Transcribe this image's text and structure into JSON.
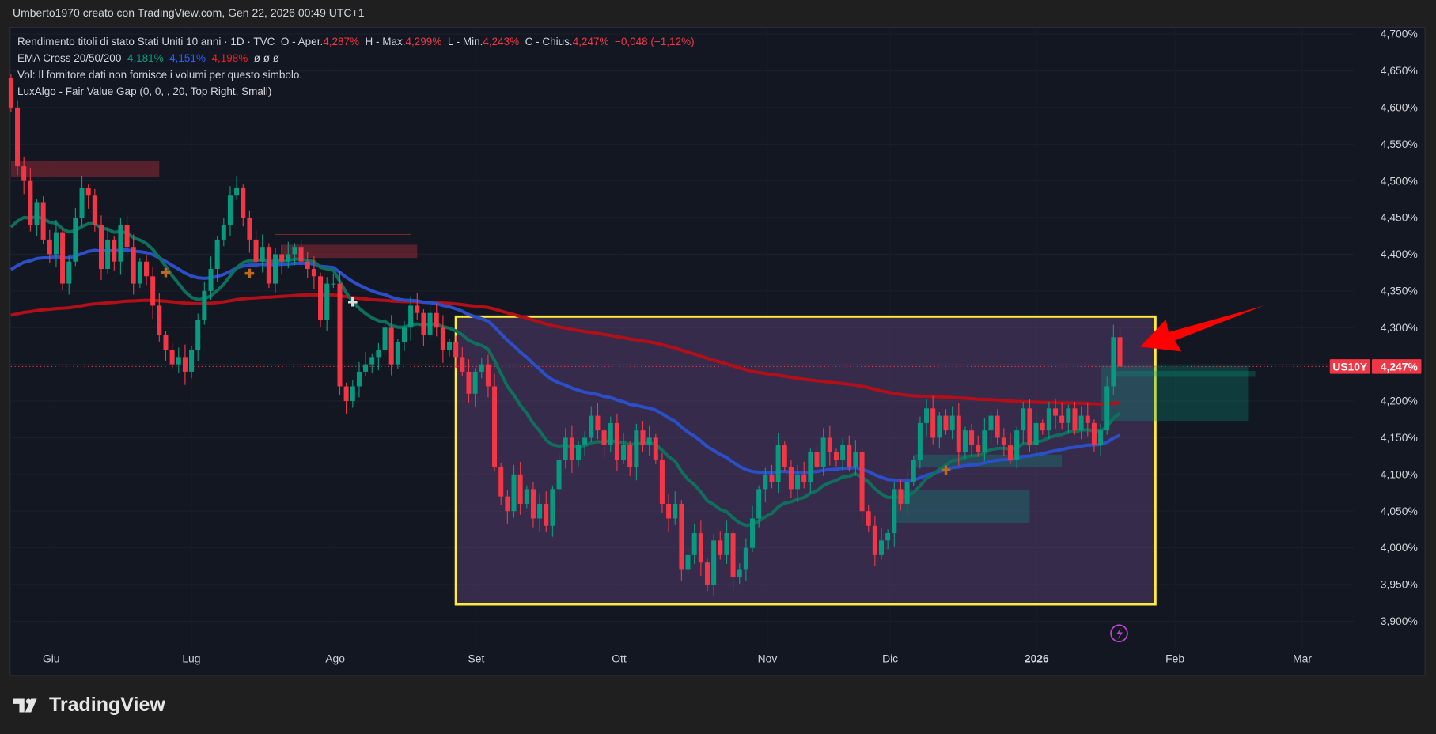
{
  "attribution": "Umberto1970 creato con TradingView.com, Gen 22, 2026 00:49 UTC+1",
  "legend": {
    "symbol": "Rendimento titoli di stato Stati Uniti 10 anni · 1D · TVC",
    "open_label": "O - Aper.",
    "open": "4,287%",
    "high_label": "H - Max.",
    "high": "4,299%",
    "low_label": "L - Min.",
    "low": "4,243%",
    "close_label": "C - Chius.",
    "close": "4,247%",
    "change": "−0,048 (−1,12%)",
    "ema_label": "EMA Cross 20/50/200",
    "ema20": "4,181%",
    "ema50": "4,151%",
    "ema200": "4,198%",
    "ema_extra": "ø  ø  ø",
    "vol": "Vol: Il fornitore dati non fornisce i volumi per questo simbolo.",
    "fvg": "LuxAlgo - Fair Value Gap (0, 0, , 20, Top Right, Small)"
  },
  "price_tag": {
    "symbol": "US10Y",
    "value": "4,247%"
  },
  "brand": "TradingView",
  "colors": {
    "up": "#089981",
    "down": "#f23645",
    "ema20": "#0e6f5c",
    "ema50": "#2b4fc9",
    "ema200": "#b20f19",
    "box": "#ffeb3b",
    "arrow": "#ff0000"
  },
  "chart_data": {
    "type": "candlestick",
    "title": "Rendimento titoli di stato Stati Uniti 10 anni · 1D · TVC",
    "ylabel": "%",
    "ylim": [
      3.88,
      4.72
    ],
    "y_ticks": [
      "4,700%",
      "4,650%",
      "4,600%",
      "4,550%",
      "4,500%",
      "4,450%",
      "4,400%",
      "4,350%",
      "4,300%",
      "4,250%",
      "4,200%",
      "4,150%",
      "4,100%",
      "4,050%",
      "4,000%",
      "3,950%",
      "3,900%"
    ],
    "y_tick_values": [
      4.7,
      4.65,
      4.6,
      4.55,
      4.5,
      4.45,
      4.4,
      4.35,
      4.3,
      4.25,
      4.2,
      4.15,
      4.1,
      4.05,
      4.0,
      3.95,
      3.9
    ],
    "x_ticks": [
      "Giu",
      "Lug",
      "Ago",
      "Set",
      "Ott",
      "Nov",
      "Dic",
      "2026",
      "Feb",
      "Mar"
    ],
    "first_open": 4.64,
    "closes": [
      4.6,
      4.52,
      4.5,
      4.44,
      4.47,
      4.42,
      4.4,
      4.43,
      4.36,
      4.39,
      4.45,
      4.49,
      4.48,
      4.44,
      4.38,
      4.42,
      4.39,
      4.44,
      4.41,
      4.36,
      4.39,
      4.37,
      4.33,
      4.29,
      4.27,
      4.25,
      4.26,
      4.24,
      4.27,
      4.31,
      4.35,
      4.38,
      4.42,
      4.44,
      4.48,
      4.49,
      4.45,
      4.42,
      4.39,
      4.41,
      4.36,
      4.4,
      4.39,
      4.4,
      4.41,
      4.39,
      4.38,
      4.37,
      4.31,
      4.36,
      4.36,
      4.22,
      4.2,
      4.22,
      4.24,
      4.25,
      4.26,
      4.27,
      4.3,
      4.25,
      4.28,
      4.3,
      4.33,
      4.32,
      4.29,
      4.32,
      4.3,
      4.27,
      4.28,
      4.26,
      4.24,
      4.21,
      4.24,
      4.25,
      4.22,
      4.11,
      4.07,
      4.05,
      4.1,
      4.06,
      4.08,
      4.04,
      4.06,
      4.03,
      4.08,
      4.12,
      4.15,
      4.12,
      4.14,
      4.15,
      4.18,
      4.16,
      4.14,
      4.17,
      4.12,
      4.14,
      4.11,
      4.16,
      4.14,
      4.15,
      4.12,
      4.06,
      4.04,
      4.06,
      3.97,
      3.99,
      4.02,
      3.98,
      3.95,
      4.01,
      3.99,
      4.02,
      3.96,
      3.97,
      4.0,
      4.04,
      4.08,
      4.1,
      4.09,
      4.14,
      4.11,
      4.08,
      4.1,
      4.09,
      4.13,
      4.11,
      4.15,
      4.13,
      4.12,
      4.14,
      4.11,
      4.13,
      4.05,
      4.03,
      3.99,
      4.01,
      4.02,
      4.08,
      4.06,
      4.09,
      4.12,
      4.17,
      4.19,
      4.15,
      4.18,
      4.16,
      4.18,
      4.13,
      4.16,
      4.14,
      4.13,
      4.16,
      4.18,
      4.15,
      4.14,
      4.12,
      4.16,
      4.19,
      4.14,
      4.17,
      4.16,
      4.19,
      4.18,
      4.17,
      4.19,
      4.16,
      4.18,
      4.17,
      4.14,
      4.16,
      4.22,
      4.287,
      4.247
    ],
    "last_candle": {
      "open": 4.287,
      "high": 4.299,
      "low": 4.243,
      "close": 4.247
    },
    "ema_seeds": {
      "ema20": 4.42,
      "ema50": 4.37,
      "ema200": 4.314
    },
    "fvg_bearish": [
      {
        "from": 0,
        "to": 23,
        "top": 4.527,
        "bottom": 4.505
      },
      {
        "from": 42,
        "to": 63,
        "top": 4.413,
        "bottom": 4.395
      }
    ],
    "fvg_bearish_line": {
      "from": 41,
      "to": 62,
      "level": 4.427
    },
    "fvg_bullish": [
      {
        "from": 137,
        "to": 158,
        "top": 4.079,
        "bottom": 4.034
      },
      {
        "from": 140,
        "to": 163,
        "top": 4.127,
        "bottom": 4.11
      },
      {
        "from": 169,
        "to": 192,
        "top": 4.248,
        "bottom": 4.173
      },
      {
        "from": 171,
        "to": 193,
        "top": 4.241,
        "bottom": 4.233
      }
    ],
    "range_box": {
      "from": 69,
      "to": 177.5,
      "top": 4.315,
      "bottom": 3.923
    },
    "cross_markers": [
      {
        "index": 24,
        "price": 4.375,
        "color": "#c06a1a"
      },
      {
        "index": 37,
        "price": 4.374,
        "color": "#c06a1a"
      },
      {
        "index": 53,
        "price": 4.335,
        "color": "#dddddd"
      },
      {
        "index": 145,
        "price": 4.106,
        "color": "#c06a1a"
      }
    ],
    "last_price": 4.247
  }
}
